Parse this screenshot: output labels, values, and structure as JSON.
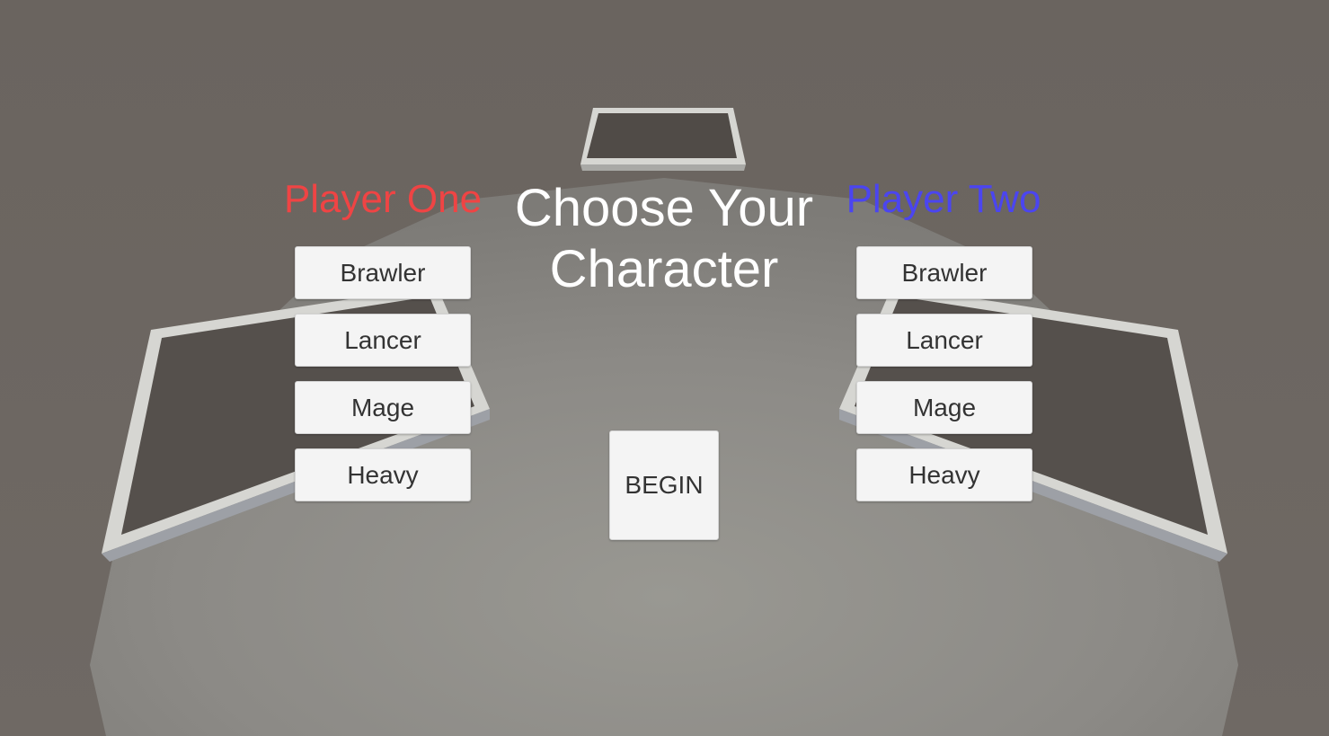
{
  "screen": {
    "title": "Choose Your Character",
    "begin_label": "BEGIN"
  },
  "player_one": {
    "label": "Player One",
    "color": "#ef4444",
    "characters": [
      "Brawler",
      "Lancer",
      "Mage",
      "Heavy"
    ]
  },
  "player_two": {
    "label": "Player Two",
    "color": "#4b45f0",
    "characters": [
      "Brawler",
      "Lancer",
      "Mage",
      "Heavy"
    ]
  },
  "colors": {
    "background": "#6b6560",
    "floor": "#8c8a86",
    "pad_frame": "#d4d4d0",
    "pad_surface": "#57524e",
    "button_face": "#f4f4f4",
    "button_text": "#333333",
    "title_text": "#ffffff"
  }
}
